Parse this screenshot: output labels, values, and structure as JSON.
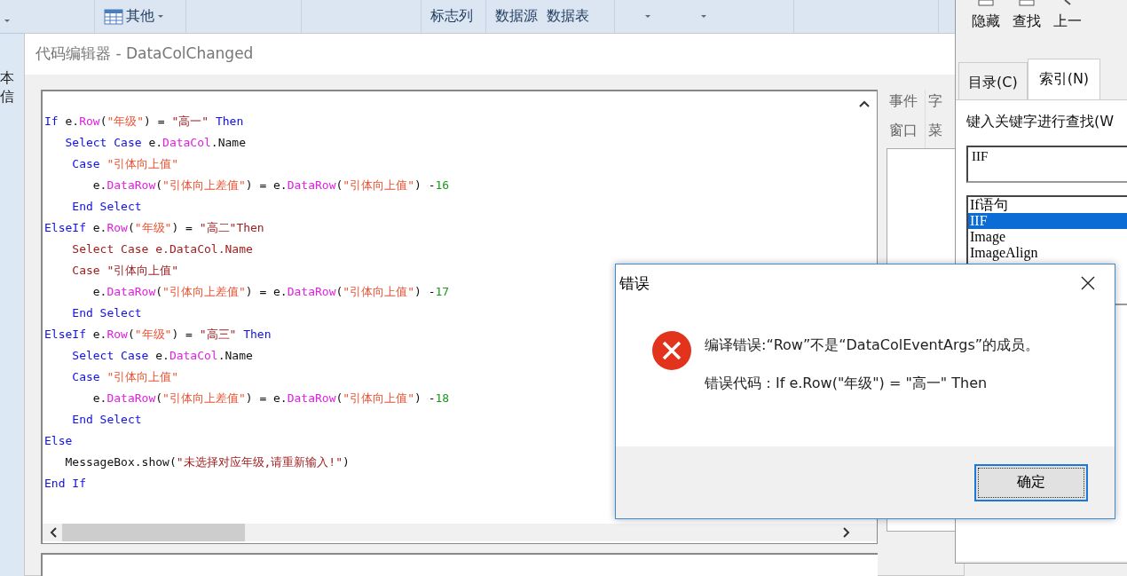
{
  "toolbar": {
    "items": [
      {
        "label": "其他",
        "kind": "menu"
      },
      {
        "label": "标志列",
        "kind": "label"
      },
      {
        "label": "数据源",
        "kind": "label"
      },
      {
        "label": "数据表",
        "kind": "label"
      }
    ]
  },
  "sheet": {
    "fragment": "本信"
  },
  "editor": {
    "title": "代码编辑器 - DataColChanged",
    "lines": [
      [
        {
          "kind": "kw",
          "text": "If"
        },
        {
          "kind": "txt",
          "text": " e."
        },
        {
          "kind": "mem",
          "text": "Row"
        },
        {
          "kind": "txt",
          "text": "("
        },
        {
          "kind": "str",
          "text": "\"年级\""
        },
        {
          "kind": "txt",
          "text": ") = "
        },
        {
          "kind": "red",
          "text": "\"高一\""
        },
        {
          "kind": "kw",
          "text": " Then"
        }
      ],
      [
        {
          "kind": "kw",
          "text": "   Select Case"
        },
        {
          "kind": "txt",
          "text": " e."
        },
        {
          "kind": "mem",
          "text": "DataCol"
        },
        {
          "kind": "txt",
          "text": ".Name"
        }
      ],
      [
        {
          "kind": "kw",
          "text": "    Case"
        },
        {
          "kind": "str",
          "text": " \"引体向上值\""
        }
      ],
      [
        {
          "kind": "txt",
          "text": "       e."
        },
        {
          "kind": "mem",
          "text": "DataRow"
        },
        {
          "kind": "txt",
          "text": "("
        },
        {
          "kind": "str",
          "text": "\"引体向上差值\""
        },
        {
          "kind": "txt",
          "text": ") = e."
        },
        {
          "kind": "mem",
          "text": "DataRow"
        },
        {
          "kind": "txt",
          "text": "("
        },
        {
          "kind": "str",
          "text": "\"引体向上值\""
        },
        {
          "kind": "txt",
          "text": ") -"
        },
        {
          "kind": "num",
          "text": "16"
        }
      ],
      [
        {
          "kind": "kw",
          "text": "    End Select"
        }
      ],
      [
        {
          "kind": "kw",
          "text": "ElseIf"
        },
        {
          "kind": "txt",
          "text": " e."
        },
        {
          "kind": "mem",
          "text": "Row"
        },
        {
          "kind": "txt",
          "text": "("
        },
        {
          "kind": "str",
          "text": "\"年级\""
        },
        {
          "kind": "txt",
          "text": ") = "
        },
        {
          "kind": "red",
          "text": "\"高二\"Then"
        }
      ],
      [
        {
          "kind": "red",
          "text": "    Select Case e.DataCol.Name"
        }
      ],
      [
        {
          "kind": "red",
          "text": "    Case \"引体向上值\""
        }
      ],
      [
        {
          "kind": "txt",
          "text": "       e."
        },
        {
          "kind": "mem",
          "text": "DataRow"
        },
        {
          "kind": "txt",
          "text": "("
        },
        {
          "kind": "str",
          "text": "\"引体向上差值\""
        },
        {
          "kind": "txt",
          "text": ") = e."
        },
        {
          "kind": "mem",
          "text": "DataRow"
        },
        {
          "kind": "txt",
          "text": "("
        },
        {
          "kind": "str",
          "text": "\"引体向上值\""
        },
        {
          "kind": "txt",
          "text": ") -"
        },
        {
          "kind": "num",
          "text": "17"
        }
      ],
      [
        {
          "kind": "kw",
          "text": "    End Select"
        }
      ],
      [
        {
          "kind": "kw",
          "text": "ElseIf"
        },
        {
          "kind": "txt",
          "text": " e."
        },
        {
          "kind": "mem",
          "text": "Row"
        },
        {
          "kind": "txt",
          "text": "("
        },
        {
          "kind": "str",
          "text": "\"年级\""
        },
        {
          "kind": "txt",
          "text": ") = "
        },
        {
          "kind": "red",
          "text": "\"高三\""
        },
        {
          "kind": "kw",
          "text": " Then"
        }
      ],
      [
        {
          "kind": "kw",
          "text": "    Select Case"
        },
        {
          "kind": "txt",
          "text": " e."
        },
        {
          "kind": "mem",
          "text": "DataCol"
        },
        {
          "kind": "txt",
          "text": ".Name"
        }
      ],
      [
        {
          "kind": "kw",
          "text": "    Case"
        },
        {
          "kind": "str",
          "text": " \"引体向上值\""
        }
      ],
      [
        {
          "kind": "txt",
          "text": "       e."
        },
        {
          "kind": "mem",
          "text": "DataRow"
        },
        {
          "kind": "txt",
          "text": "("
        },
        {
          "kind": "str",
          "text": "\"引体向上差值\""
        },
        {
          "kind": "txt",
          "text": ") = e."
        },
        {
          "kind": "mem",
          "text": "DataRow"
        },
        {
          "kind": "txt",
          "text": "("
        },
        {
          "kind": "str",
          "text": "\"引体向上值\""
        },
        {
          "kind": "txt",
          "text": ") -"
        },
        {
          "kind": "num",
          "text": "18"
        }
      ],
      [
        {
          "kind": "kw",
          "text": "    End Select"
        }
      ],
      [
        {
          "kind": "kw",
          "text": "Else"
        }
      ],
      [
        {
          "kind": "txt",
          "text": "   MessageBox.show("
        },
        {
          "kind": "red",
          "text": "\"未选择对应年级,请重新输入!\""
        },
        {
          "kind": "txt",
          "text": ")"
        }
      ],
      [
        {
          "kind": "kw",
          "text": "End If"
        }
      ]
    ],
    "side_tabs": [
      {
        "label": "事件"
      },
      {
        "label": "字"
      },
      {
        "label": "窗口"
      },
      {
        "label": "菜"
      }
    ]
  },
  "help": {
    "buttons": [
      {
        "label": "隐藏"
      },
      {
        "label": "查找"
      },
      {
        "label": "上一"
      }
    ],
    "tabs": [
      {
        "label": "目录(C)",
        "selected": false
      },
      {
        "label": "索引(N)",
        "selected": true
      }
    ],
    "prompt": "键入关键字进行查找(W",
    "search_value": "IIF",
    "results": [
      {
        "label": "If语句",
        "selected": false
      },
      {
        "label": "IIF",
        "selected": true
      },
      {
        "label": "Image",
        "selected": false
      },
      {
        "label": "ImageAlign",
        "selected": false
      }
    ]
  },
  "dialog": {
    "title": "错误",
    "message": "编译错误:“Row”不是“DataColEventArgs”的成员。",
    "detail": "错误代码：If e.Row(\"年级\") = \"高一\" Then",
    "button": "确定"
  }
}
